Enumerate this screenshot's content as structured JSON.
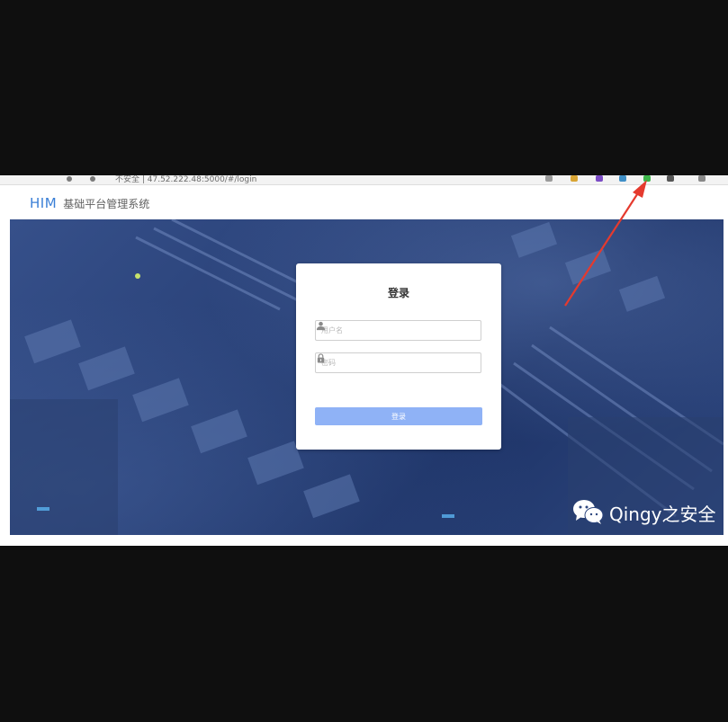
{
  "browser": {
    "address_url": "不安全 | 47.52.222.48:5000/#/login"
  },
  "header": {
    "logo": "HIM",
    "title": "基础平台管理系统"
  },
  "login": {
    "title": "登录",
    "username_placeholder": "用户名",
    "password_placeholder": "密码",
    "submit_label": "登录"
  },
  "watermark": {
    "text": "Qingy之安全"
  },
  "colors": {
    "brand": "#3a7fd6",
    "button": "#8fb2f6",
    "arrow": "#e53a2e",
    "background": "#0f0f0f"
  },
  "icons": [
    "user-icon",
    "lock-icon",
    "wechat-icon",
    "arrow-annotation"
  ]
}
